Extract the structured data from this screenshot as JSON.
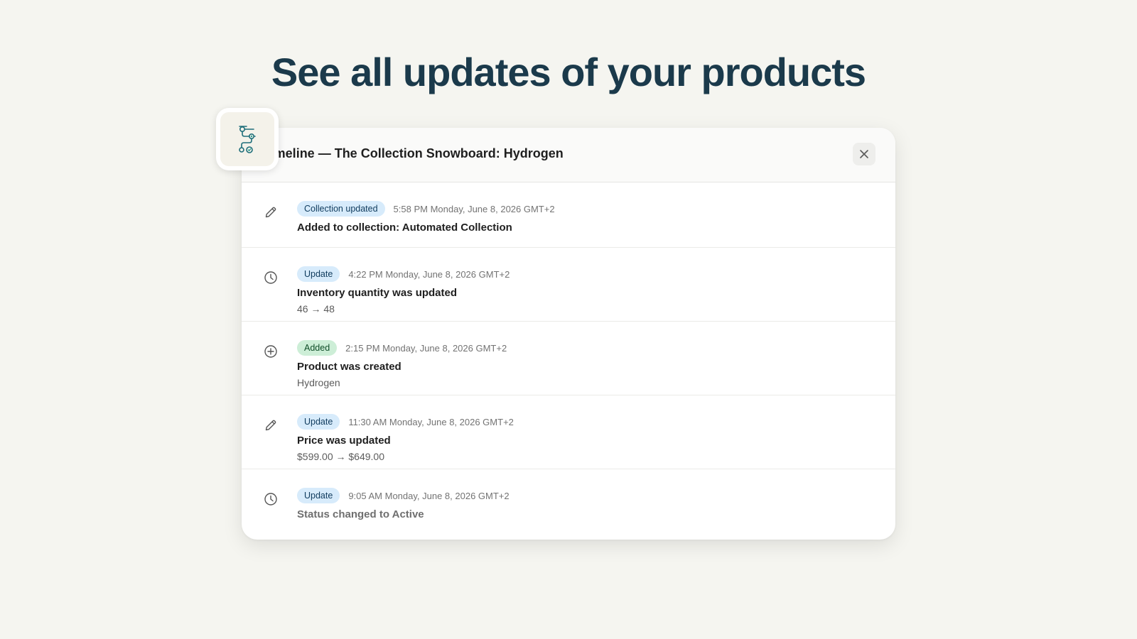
{
  "headline": "See all updates of your products",
  "modal": {
    "title": "Timeline — The Collection Snowboard: Hydrogen",
    "close_icon": "close-icon"
  },
  "app_icon": "timeline-app-icon",
  "colors": {
    "headline": "#1b3a4b",
    "badge_blue_bg": "#d7ebfb",
    "badge_green_bg": "#cdeed7",
    "accent_teal": "#1f8a7f"
  },
  "events": [
    {
      "icon": "pencil-icon",
      "badge": "Collection updated",
      "badge_color": "blue",
      "timestamp": "5:58 PM Monday, June 8, 2026 GMT+2",
      "title": "Added to collection: Automated Collection",
      "detail": ""
    },
    {
      "icon": "clock-icon",
      "badge": "Update",
      "badge_color": "blue",
      "timestamp": "4:22 PM Monday, June 8, 2026 GMT+2",
      "title": "Inventory quantity was updated",
      "detail": "46 → 48"
    },
    {
      "icon": "plus-circle-icon",
      "badge": "Added",
      "badge_color": "green",
      "timestamp": "2:15 PM Monday, June 8, 2026 GMT+2",
      "title": "Product was created",
      "detail": "Hydrogen"
    },
    {
      "icon": "pencil-icon",
      "badge": "Update",
      "badge_color": "blue",
      "timestamp": "11:30 AM Monday, June 8, 2026 GMT+2",
      "title": "Price was updated",
      "detail": "$599.00 → $649.00"
    },
    {
      "icon": "clock-icon",
      "badge": "Update",
      "badge_color": "blue",
      "timestamp": "9:05 AM Monday, June 8, 2026 GMT+2",
      "title": "Status changed to Active",
      "detail": ""
    }
  ]
}
